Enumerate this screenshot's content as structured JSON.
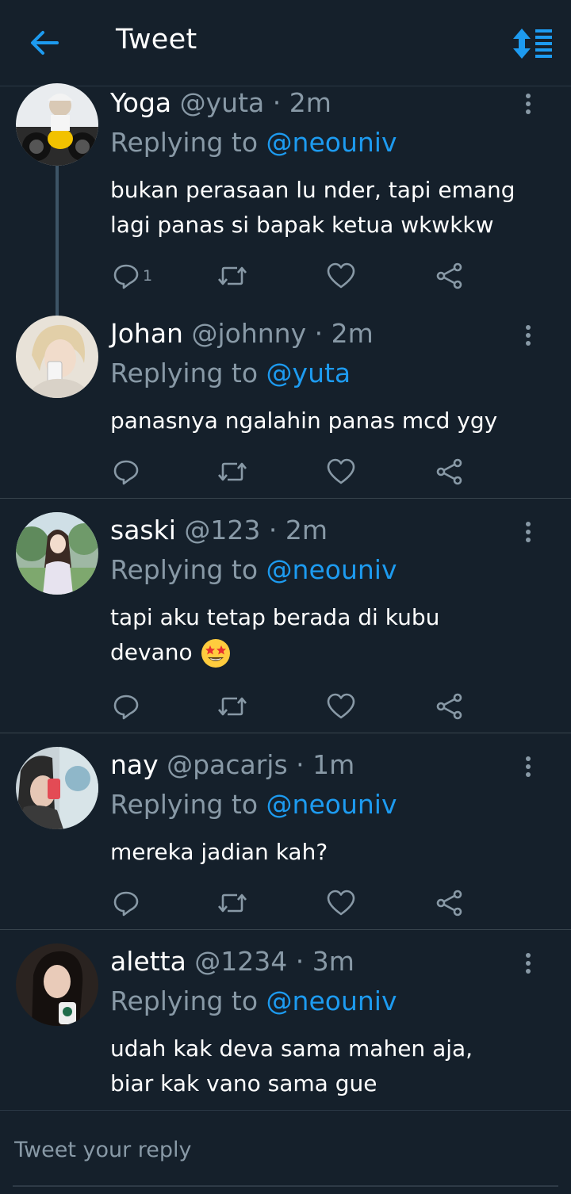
{
  "header": {
    "title": "Tweet",
    "back_icon": "arrow-left-icon",
    "sort_icon": "sort-icon"
  },
  "colors": {
    "background": "#15202b",
    "accent": "#1d9bf0",
    "muted": "#8899a6",
    "divider": "#38444d"
  },
  "tweets": [
    {
      "name": "Yoga",
      "handle": "@yuta",
      "time": "2m",
      "reply_label": "Replying to",
      "reply_to": "@neouniv",
      "text": "bukan perasaan lu nder, tapi emang lagi panas si bapak ketua wkwkkw",
      "reply_count": "1"
    },
    {
      "name": "Johan",
      "handle": "@johnny",
      "time": "2m",
      "reply_label": "Replying to",
      "reply_to": "@yuta",
      "text": "panasnya ngalahin panas mcd ygy",
      "reply_count": ""
    },
    {
      "name": "saski",
      "handle": "@123",
      "time": "2m",
      "reply_label": "Replying to",
      "reply_to": "@neouniv",
      "text": "tapi aku tetap berada di kubu devano",
      "emoji": "star-struck-emoji",
      "reply_count": ""
    },
    {
      "name": "nay",
      "handle": "@pacarjs",
      "time": "1m",
      "reply_label": "Replying to",
      "reply_to": "@neouniv",
      "text": "mereka jadian kah?",
      "reply_count": ""
    },
    {
      "name": "aletta",
      "handle": "@1234",
      "time": "3m",
      "reply_label": "Replying to",
      "reply_to": "@neouniv",
      "text": "udah kak deva sama mahen aja, biar kak vano sama gue",
      "reply_count": ""
    }
  ],
  "reply_bar": {
    "placeholder": "Tweet your reply"
  }
}
